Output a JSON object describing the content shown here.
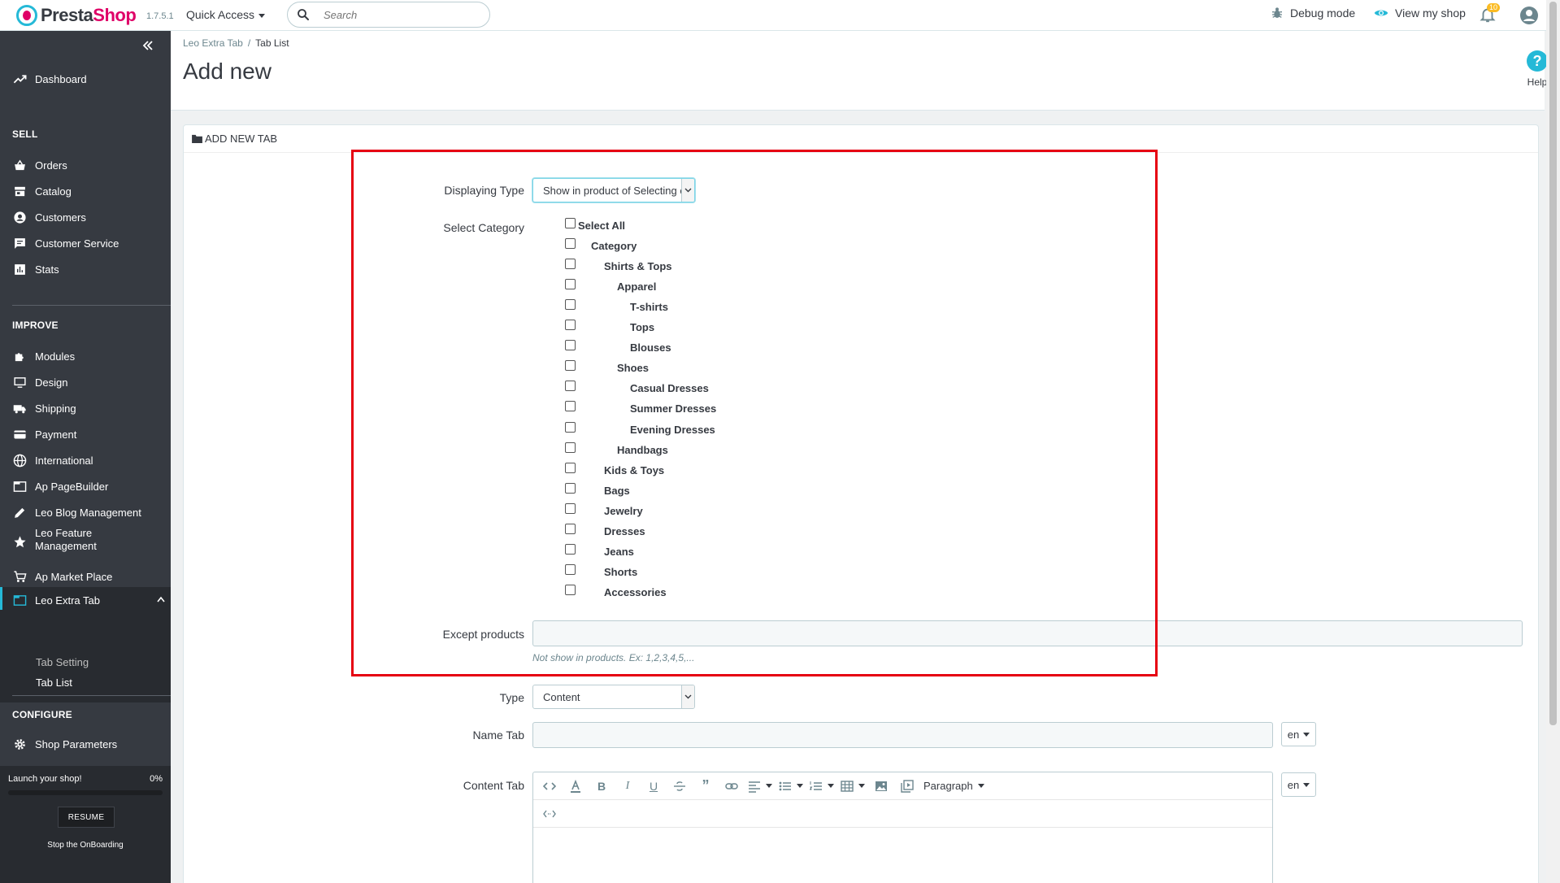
{
  "header": {
    "brand_prefix": "Presta",
    "brand_suffix": "Shop",
    "version": "1.7.5.1",
    "quick_access": "Quick Access",
    "search_placeholder": "Search",
    "debug_mode": "Debug mode",
    "view_shop": "View my shop",
    "notification_count": "10"
  },
  "sidebar": {
    "dashboard": "Dashboard",
    "sell_title": "SELL",
    "sell_items": [
      "Orders",
      "Catalog",
      "Customers",
      "Customer Service",
      "Stats"
    ],
    "improve_title": "IMPROVE",
    "improve_items": [
      "Modules",
      "Design",
      "Shipping",
      "Payment",
      "International",
      "Ap PageBuilder",
      "Leo Blog Management",
      "Leo Feature Management",
      "Ap Market Place",
      "Leo Extra Tab"
    ],
    "sub_items": [
      "Tab Setting",
      "Tab List"
    ],
    "configure_title": "CONFIGURE",
    "configure_items": [
      "Shop Parameters"
    ],
    "onboarding": {
      "label": "Launch your shop!",
      "percent": "0%",
      "progress": 0,
      "resume": "RESUME",
      "stop": "Stop the OnBoarding"
    }
  },
  "page": {
    "breadcrumb": [
      "Leo Extra Tab",
      "Tab List"
    ],
    "title": "Add new",
    "help": "Help"
  },
  "panel": {
    "heading": "ADD NEW TAB"
  },
  "form": {
    "displaying_type_label": "Displaying Type",
    "displaying_type_value": "Show in product of Selecting c",
    "select_category_label": "Select Category",
    "categories": [
      {
        "name": "Select All",
        "level": 0
      },
      {
        "name": "Category",
        "level": 1
      },
      {
        "name": "Shirts & Tops",
        "level": 2
      },
      {
        "name": "Apparel",
        "level": 3
      },
      {
        "name": "T-shirts",
        "level": 4
      },
      {
        "name": "Tops",
        "level": 4
      },
      {
        "name": "Blouses",
        "level": 4
      },
      {
        "name": "Shoes",
        "level": 3
      },
      {
        "name": "Casual Dresses",
        "level": 4
      },
      {
        "name": "Summer Dresses",
        "level": 4
      },
      {
        "name": "Evening Dresses",
        "level": 4
      },
      {
        "name": "Handbags",
        "level": 3
      },
      {
        "name": "Kids & Toys",
        "level": 2
      },
      {
        "name": "Bags",
        "level": 2
      },
      {
        "name": "Jewelry",
        "level": 2
      },
      {
        "name": "Dresses",
        "level": 2
      },
      {
        "name": "Jeans",
        "level": 2
      },
      {
        "name": "Shorts",
        "level": 2
      },
      {
        "name": "Accessories",
        "level": 2
      }
    ],
    "except_products_label": "Except products",
    "except_products_value": "",
    "except_products_hint": "Not show in products. Ex: 1,2,3,4,5,...",
    "type_label": "Type",
    "type_value": "Content",
    "name_tab_label": "Name Tab",
    "name_tab_lang": "en",
    "content_tab_label": "Content Tab",
    "content_tab_lang": "en",
    "editor_paragraph": "Paragraph"
  },
  "colors": {
    "accent": "#25b9d7",
    "brand": "#df0067",
    "sidebar_bg": "#363a41",
    "highlight": "#e60012"
  }
}
